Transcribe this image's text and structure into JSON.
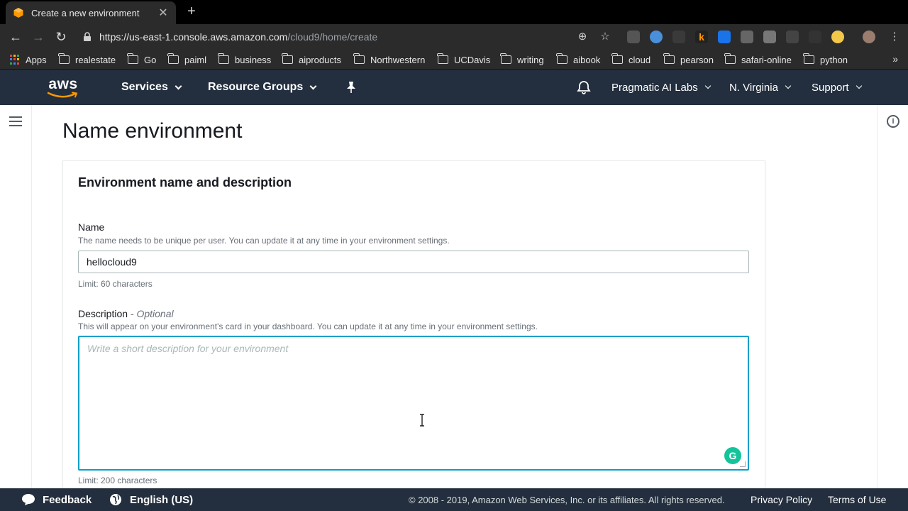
{
  "browser": {
    "tab_title": "Create a new environment",
    "url_host": "https://us-east-1.console.aws.amazon.com",
    "url_path": "/cloud9/home/create",
    "favicon_color": "#ff9900"
  },
  "bookmarks": {
    "apps_label": "Apps",
    "folders": [
      "realestate",
      "Go",
      "paiml",
      "business",
      "aiproducts",
      "Northwestern",
      "UCDavis",
      "writing",
      "aibook",
      "cloud",
      "pearson",
      "safari-online",
      "python"
    ],
    "more_label": "»"
  },
  "aws_nav": {
    "logo_text": "aws",
    "services_label": "Services",
    "resource_groups_label": "Resource Groups",
    "account_label": "Pragmatic AI Labs",
    "region_label": "N. Virginia",
    "support_label": "Support",
    "brand_color": "#232f3e",
    "accent_color": "#ff9900"
  },
  "page": {
    "title": "Name environment",
    "section_title": "Environment name and description",
    "name_label": "Name",
    "name_hint": "The name needs to be unique per user. You can update it at any time in your environment settings.",
    "name_value": "hellocloud9",
    "name_limit": "Limit: 60 characters",
    "description_label": "Description",
    "description_optional": "- Optional",
    "description_hint": "This will appear on your environment's card in your dashboard. You can update it at any time in your environment settings.",
    "description_placeholder": "Write a short description for your environment",
    "description_limit": "Limit: 200 characters",
    "focus_color": "#00a1c9"
  },
  "footer": {
    "feedback_label": "Feedback",
    "language_label": "English (US)",
    "copyright": "© 2008 - 2019, Amazon Web Services, Inc. or its affiliates. All rights reserved.",
    "privacy_label": "Privacy Policy",
    "terms_label": "Terms of Use"
  }
}
